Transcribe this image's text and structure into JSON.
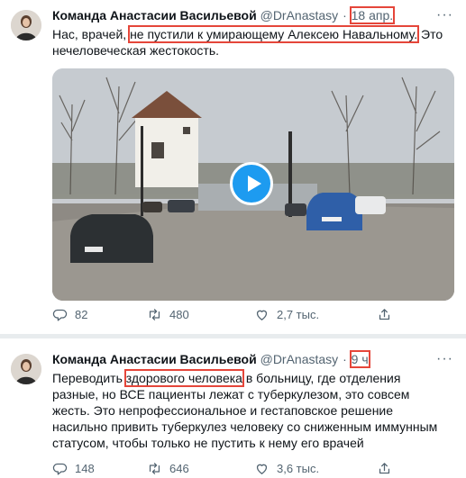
{
  "tweets": [
    {
      "author": "Команда Анастасии Васильевой",
      "handle": "@DrAnastasy",
      "separator": "·",
      "time": "18 апр.",
      "text_before": "Нас, врачей, ",
      "text_highlight": "не пустили к умирающему Алексею Навальному.",
      "text_after": " Это нечеловеческая жестокость.",
      "more": "···",
      "replies": "82",
      "retweets": "480",
      "likes": "2,7 тыс."
    },
    {
      "author": "Команда Анастасии Васильевой",
      "handle": "@DrAnastasy",
      "separator": "·",
      "time": "9 ч",
      "text_before": "Переводить ",
      "text_highlight": "здорового человека",
      "text_after": " в больницу, где отделения разные, но ВСЕ пациенты лежат с туберкулезом, это совсем жесть. Это непрофессиональное и гестаповское решение  насильно привить туберкулез человеку со сниженным иммунным статусом, чтобы только не пустить к нему его врачей",
      "more": "···",
      "replies": "148",
      "retweets": "646",
      "likes": "3,6 тыс."
    }
  ],
  "colors": {
    "highlight_box": "#e5463a",
    "play_button": "#1d9bf0",
    "secondary_text": "#536471"
  },
  "icons": [
    "reply-icon",
    "retweet-icon",
    "like-icon",
    "share-icon",
    "play-icon",
    "more-icon"
  ]
}
